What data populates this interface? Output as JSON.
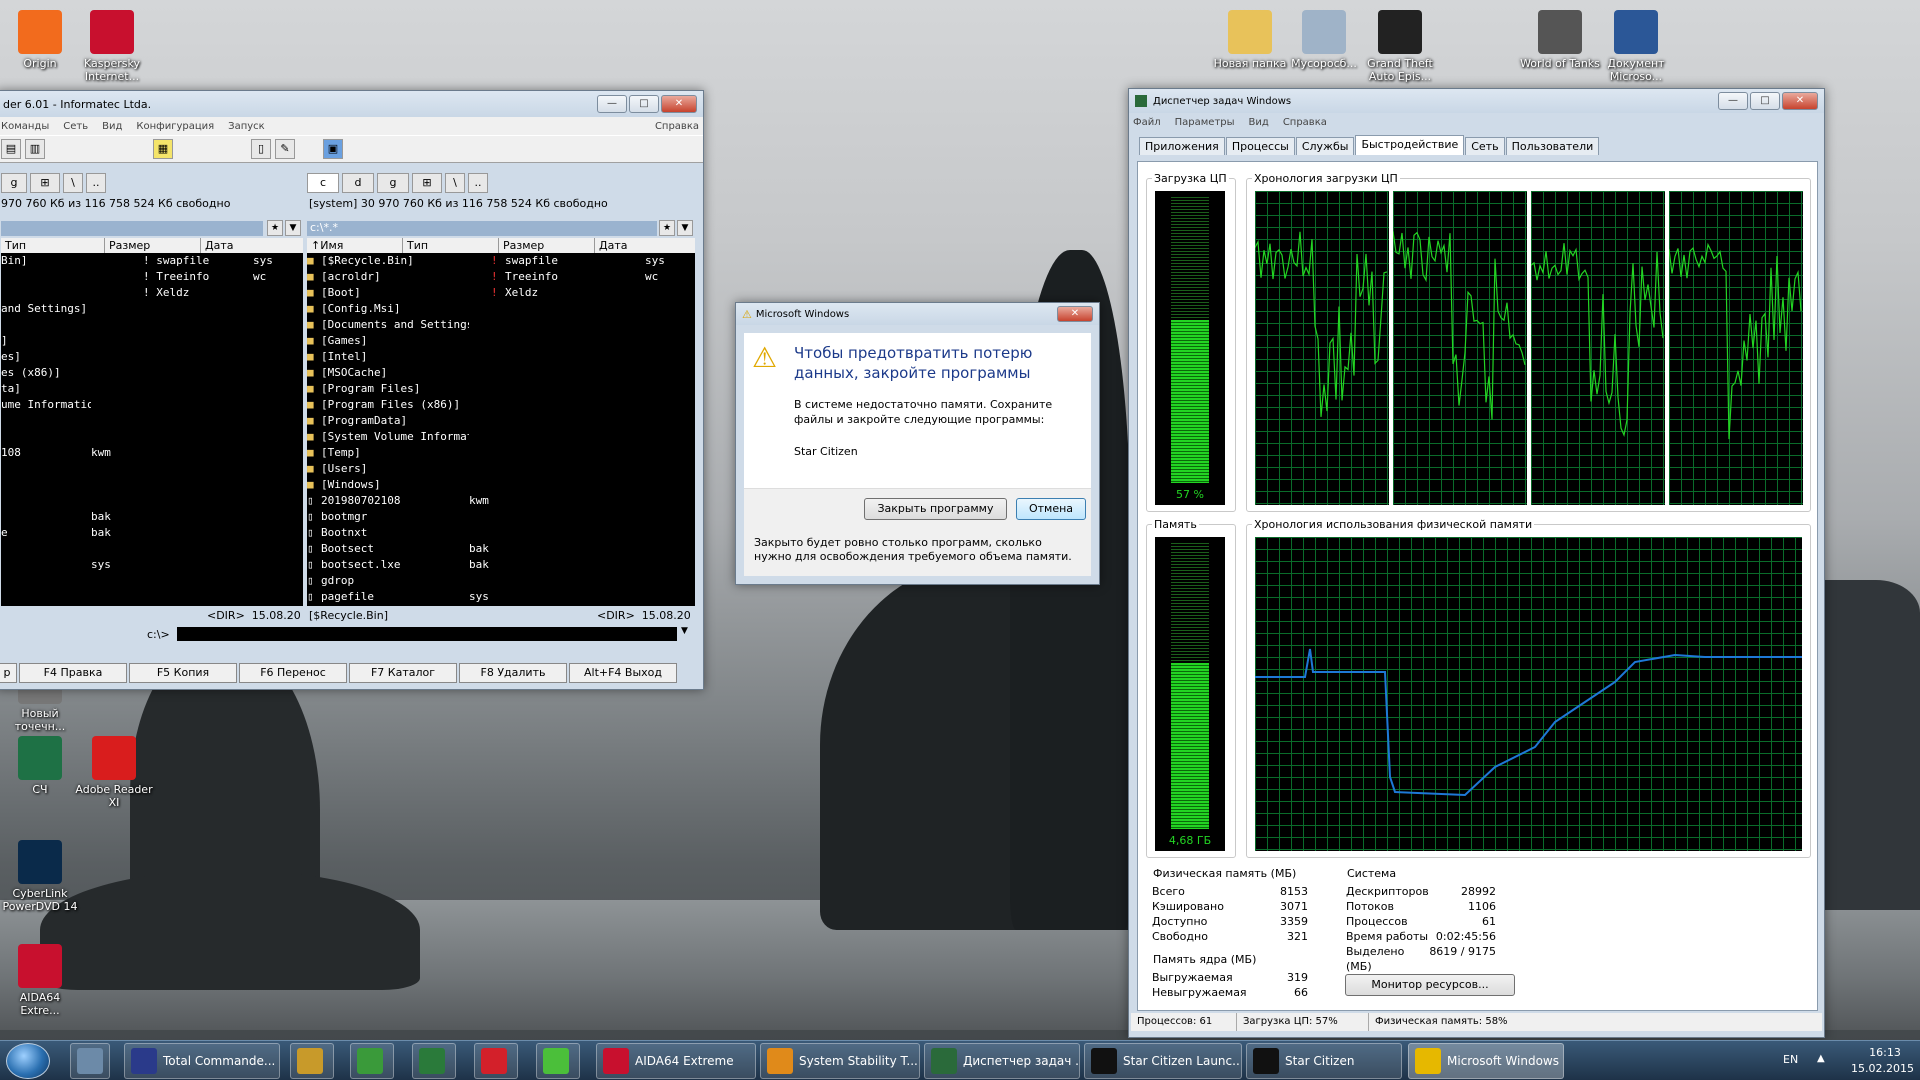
{
  "colors": {
    "graph_green": "#23d423",
    "memory_line": "#1e78d8",
    "grid": "#0a6b2a",
    "taskbar": "#1e3248",
    "cancel_focus": "#3c7fb1"
  },
  "desktop_icons": [
    {
      "label": "Origin",
      "icon": "origin-icon",
      "color": "#f26b1d"
    },
    {
      "label": "Kaspersky Internet...",
      "icon": "kaspersky-icon",
      "color": "#c8102e"
    },
    {
      "label": "Новая папка",
      "icon": "folder-icon",
      "color": "#e8c25a"
    },
    {
      "label": "Мусоросб...",
      "icon": "recycle-bin-icon",
      "color": "#9fb3c8"
    },
    {
      "label": "Grand Theft Auto Epis...",
      "icon": "gta-icon",
      "color": "#222"
    },
    {
      "label": "World of Tanks",
      "icon": "wot-icon",
      "color": "#555"
    },
    {
      "label": "Документ Microso...",
      "icon": "word-doc-icon",
      "color": "#2b5797"
    },
    {
      "label": "Новый точечн...",
      "icon": "bitmap-icon",
      "color": "#777"
    },
    {
      "label": "СЧ",
      "icon": "excel-icon",
      "color": "#1e7145"
    },
    {
      "label": "Adobe Reader XI",
      "icon": "adobe-reader-icon",
      "color": "#d91d1d"
    },
    {
      "label": "CyberLink PowerDVD 14",
      "icon": "powerdvd-icon",
      "color": "#0a2a4a"
    },
    {
      "label": "AIDA64 Extre...",
      "icon": "aida64-icon",
      "color": "#c8102e"
    }
  ],
  "total_commander": {
    "title": "der 6.01 - Informatec Ltda.",
    "menu": [
      "Команды",
      "Сеть",
      "Вид",
      "Конфигурация",
      "Запуск",
      "Справка"
    ],
    "left": {
      "drive_info": "970 760 Кб из 116 758 524 Кб свободно",
      "headers": [
        "Тип",
        "Размер",
        "Дата"
      ],
      "rows": [
        [
          "Bin]",
          "",
          "",
          "! swapfile",
          "sys"
        ],
        [
          "",
          "",
          "",
          "! Treeinfo",
          "wc"
        ],
        [
          "",
          "",
          "",
          "! Xeldz",
          ""
        ],
        [
          "and Settings]",
          "",
          "",
          "",
          ""
        ],
        [
          "",
          "",
          "",
          "",
          ""
        ],
        [
          "]",
          "",
          "",
          "",
          ""
        ],
        [
          "es]",
          "",
          "",
          "",
          ""
        ],
        [
          "es (x86)]",
          "",
          "",
          "",
          ""
        ],
        [
          "ta]",
          "",
          "",
          "",
          ""
        ],
        [
          "ume Information]",
          "",
          "",
          "",
          ""
        ],
        [
          "",
          "",
          "",
          "",
          ""
        ],
        [
          "",
          "",
          "",
          "",
          ""
        ],
        [
          "108",
          "kwm",
          "",
          "",
          ""
        ],
        [
          "",
          "",
          "",
          "",
          ""
        ],
        [
          "",
          "",
          "",
          "",
          ""
        ],
        [
          "",
          "",
          "",
          "",
          ""
        ],
        [
          "",
          "bak",
          "",
          "",
          ""
        ],
        [
          "e",
          "bak",
          "",
          "",
          ""
        ],
        [
          "",
          "",
          "",
          "",
          ""
        ],
        [
          "",
          "sys",
          "",
          "",
          ""
        ]
      ],
      "footer": "<DIR>  15.08.20"
    },
    "right": {
      "drive_buttons": [
        "c",
        "d",
        "g"
      ],
      "drive_info": "[system]  30 970 760 Кб из 116 758 524 Кб свободно",
      "path": "c:\\*.*",
      "headers": [
        "↑Имя",
        "Тип",
        "Размер",
        "Дата"
      ],
      "files": [
        {
          "name": "[$Recycle.Bin]",
          "type": "",
          "dir": true
        },
        {
          "name": "[acroldr]",
          "type": "",
          "dir": true
        },
        {
          "name": "[Boot]",
          "type": "",
          "dir": true
        },
        {
          "name": "[Config.Msi]",
          "type": "",
          "dir": true
        },
        {
          "name": "[Documents and Settings]",
          "type": "",
          "dir": true
        },
        {
          "name": "[Games]",
          "type": "",
          "dir": true
        },
        {
          "name": "[Intel]",
          "type": "",
          "dir": true
        },
        {
          "name": "[MSOCache]",
          "type": "",
          "dir": true
        },
        {
          "name": "[Program Files]",
          "type": "",
          "dir": true
        },
        {
          "name": "[Program Files (x86)]",
          "type": "",
          "dir": true
        },
        {
          "name": "[ProgramData]",
          "type": "",
          "dir": true
        },
        {
          "name": "[System Volume Information]",
          "type": "",
          "dir": true
        },
        {
          "name": "[Temp]",
          "type": "",
          "dir": true
        },
        {
          "name": "[Users]",
          "type": "",
          "dir": true
        },
        {
          "name": "[Windows]",
          "type": "",
          "dir": true
        },
        {
          "name": "201980702108",
          "type": "kwm",
          "dir": false
        },
        {
          "name": "bootmgr",
          "type": "",
          "dir": false
        },
        {
          "name": "Bootnxt",
          "type": "",
          "dir": false
        },
        {
          "name": "Bootsect",
          "type": "bak",
          "dir": false
        },
        {
          "name": "bootsect.lxe",
          "type": "bak",
          "dir": false
        },
        {
          "name": "gdrop",
          "type": "",
          "dir": false
        },
        {
          "name": "pagefile",
          "type": "sys",
          "dir": false
        }
      ],
      "side_files": [
        {
          "name": "swapfile",
          "type": "sys"
        },
        {
          "name": "Treeinfo",
          "type": "wc"
        },
        {
          "name": "Xeldz",
          "type": ""
        }
      ],
      "footer_name": "[$Recycle.Bin]",
      "footer_info": "<DIR>  15.08.20"
    },
    "cmd_prompt": "c:\\>",
    "fkeys": [
      "р",
      "F4 Правка",
      "F5 Копия",
      "F6 Перенос",
      "F7 Каталог",
      "F8 Удалить",
      "Alt+F4 Выход"
    ]
  },
  "dialog": {
    "title": "Microsoft Windows",
    "heading": "Чтобы предотвратить потерю данных, закройте программы",
    "message": "В системе недостаточно памяти. Сохраните файлы и закройте следующие программы:",
    "program": "Star Citizen",
    "close_button": "Закрыть программу",
    "cancel_button": "Отмена",
    "footer": "Закрыто будет ровно столько программ, сколько нужно для освобождения требуемого объема памяти."
  },
  "task_manager": {
    "title": "Диспетчер задач Windows",
    "menu": [
      "Файл",
      "Параметры",
      "Вид",
      "Справка"
    ],
    "tabs": [
      "Приложения",
      "Процессы",
      "Службы",
      "Быстродействие",
      "Сеть",
      "Пользователи"
    ],
    "active_tab": "Быстродействие",
    "cpu_usage_label": "Загрузка ЦП",
    "cpu_usage_value": "57 %",
    "cpu_usage_fraction": 0.57,
    "cpu_history_label": "Хронология загрузки ЦП",
    "memory_label": "Память",
    "memory_value": "4,68 ГБ",
    "memory_fraction": 0.58,
    "memory_history_label": "Хронология использования физической памяти",
    "physical_memory": {
      "title": "Физическая память (МБ)",
      "rows": [
        [
          "Всего",
          "8153"
        ],
        [
          "Кэшировано",
          "3071"
        ],
        [
          "Доступно",
          "3359"
        ],
        [
          "Свободно",
          "321"
        ]
      ]
    },
    "kernel_memory": {
      "title": "Память ядра (МБ)",
      "rows": [
        [
          "Выгружаемая",
          "319"
        ],
        [
          "Невыгружаемая",
          "66"
        ]
      ]
    },
    "system": {
      "title": "Система",
      "rows": [
        [
          "Дескрипторов",
          "28992"
        ],
        [
          "Потоков",
          "1106"
        ],
        [
          "Процессов",
          "61"
        ],
        [
          "Время работы",
          "0:02:45:56"
        ],
        [
          "Выделено (МБ)",
          "8619 / 9175"
        ]
      ]
    },
    "resource_monitor_button": "Монитор ресурсов...",
    "status": [
      "Процессов: 61",
      "Загрузка ЦП: 57%",
      "Физическая память: 58%"
    ]
  },
  "taskbar": {
    "items": [
      {
        "label": "",
        "icon": "calculator-icon",
        "color": "#6c8aa8"
      },
      {
        "label": "Total Commande...",
        "icon": "total-commander-icon",
        "color": "#2a3a8a"
      },
      {
        "label": "",
        "icon": "pencil-icon",
        "color": "#c89a2a"
      },
      {
        "label": "",
        "icon": "utorrent-icon",
        "color": "#3a9a3a"
      },
      {
        "label": "",
        "icon": "book-icon",
        "color": "#2a7a3a"
      },
      {
        "label": "",
        "icon": "opera-icon",
        "color": "#d3202a"
      },
      {
        "label": "",
        "icon": "icq-icon",
        "color": "#4bbf3a"
      },
      {
        "label": "AIDA64 Extreme",
        "icon": "aida64-icon",
        "color": "#c8102e"
      },
      {
        "label": "System Stability T...",
        "icon": "flame-icon",
        "color": "#e08a1a"
      },
      {
        "label": "Диспетчер задач ...",
        "icon": "task-manager-icon",
        "color": "#2a6a3a"
      },
      {
        "label": "Star Citizen Launc...",
        "icon": "star-citizen-icon",
        "color": "#111"
      },
      {
        "label": "Star Citizen",
        "icon": "star-citizen-icon",
        "color": "#111"
      },
      {
        "label": "Microsoft Windows",
        "icon": "warning-icon",
        "color": "#e6b800"
      }
    ],
    "lang": "EN",
    "time": "16:13",
    "date": "15.02.2015"
  }
}
